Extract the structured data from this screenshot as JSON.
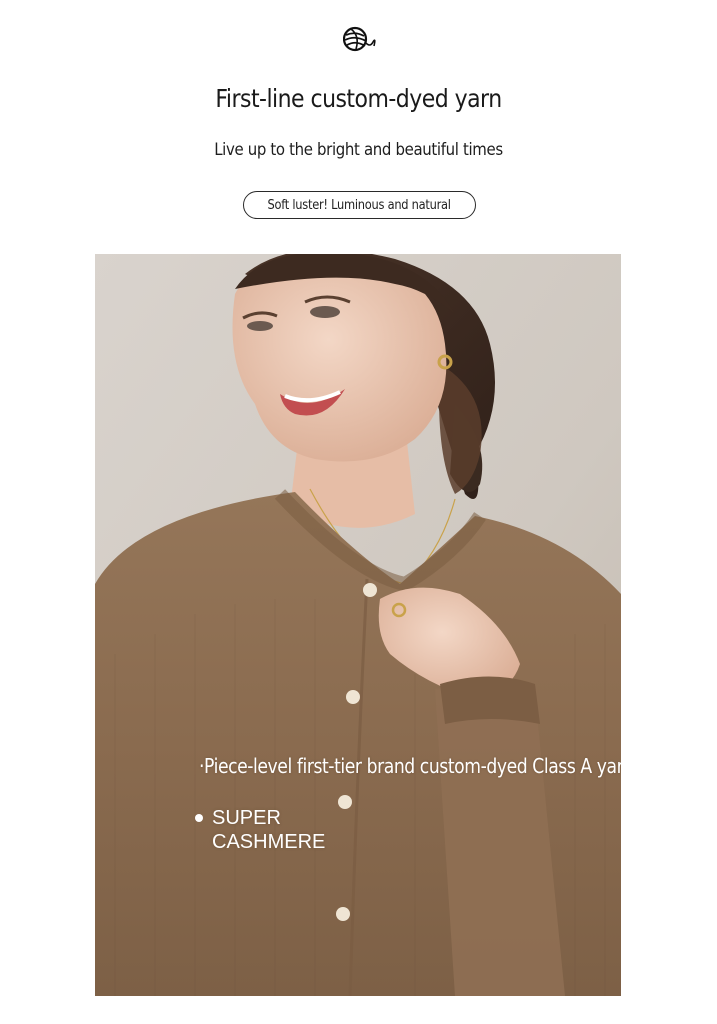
{
  "logo": {
    "icon": "yarn-ball-icon"
  },
  "headline": "First-line custom-dyed yarn",
  "subheadline": "Live up to the bright and beautiful times",
  "pill_label": "Soft luster! Luminous and natural",
  "photo": {
    "caption": "·Piece-level first-tier brand custom-dyed Class A yarn",
    "brand_line1": "SUPER",
    "brand_line2": "CASHMERE"
  },
  "colors": {
    "sweater": "#8a6b4f",
    "background_wall": "#d6d0c9",
    "text": "#1c1c1c"
  }
}
